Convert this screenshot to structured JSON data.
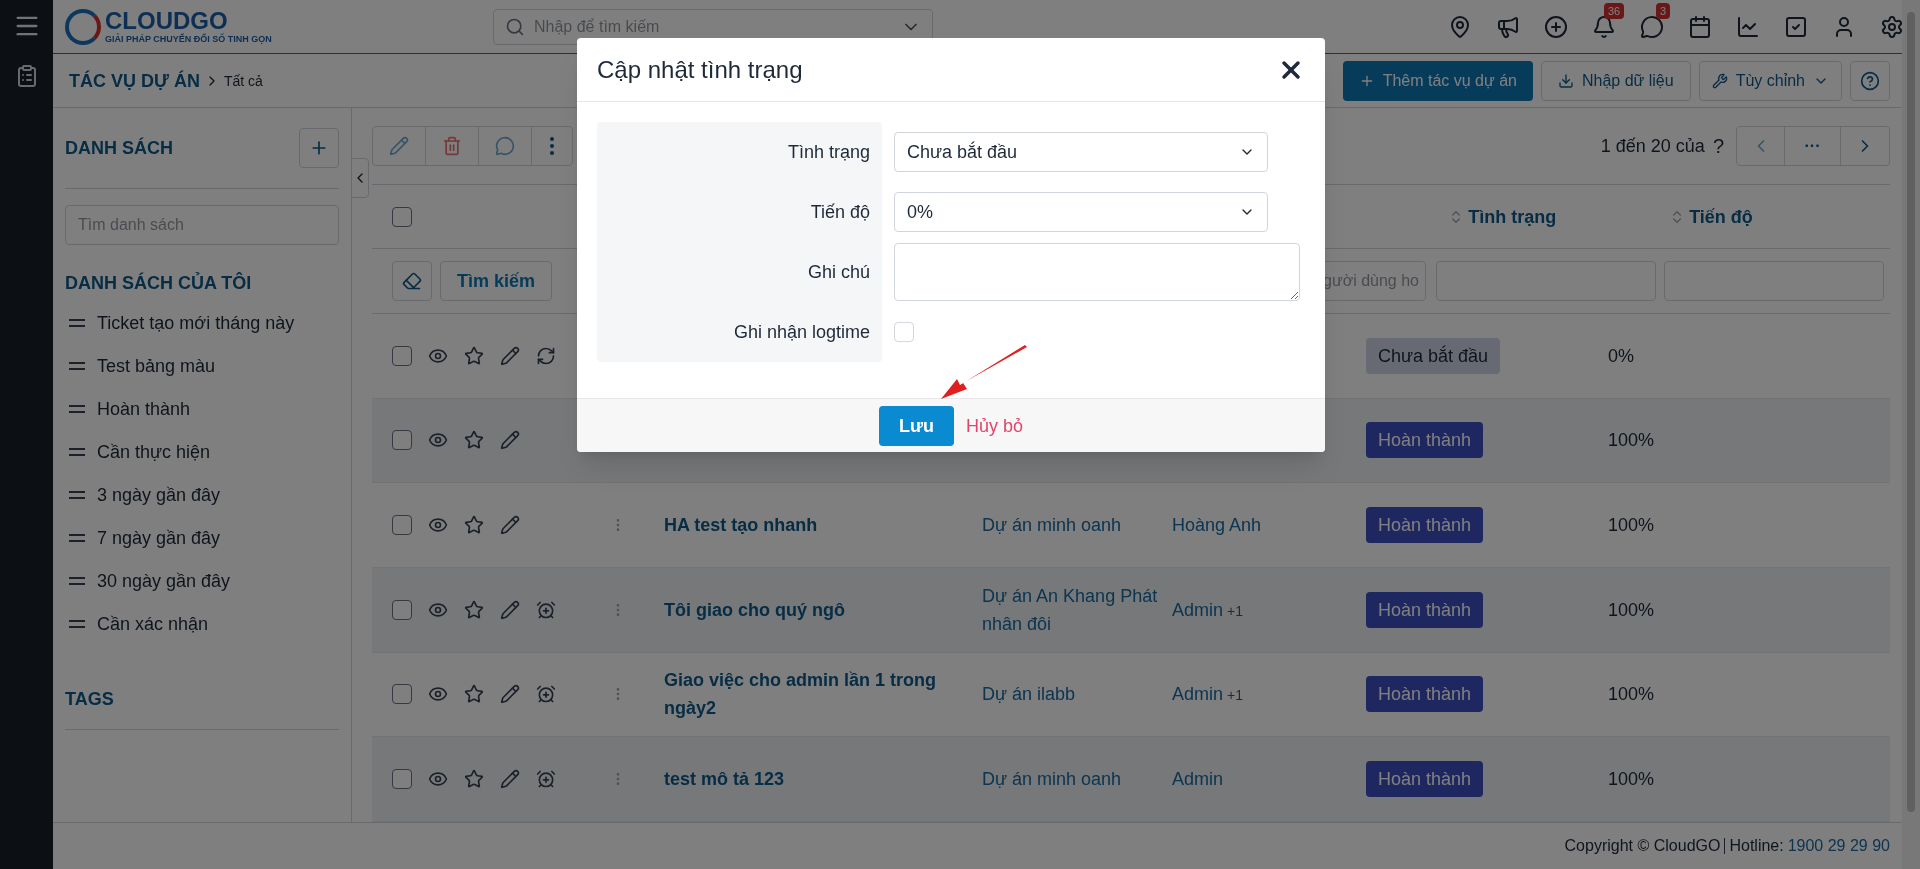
{
  "topbar": {
    "logo": "CLOUDGO",
    "logo_tagline": "GIẢI PHÁP CHUYỂN ĐỔI SỐ TINH GỌN",
    "search": {
      "placeholder": "Nhập để tìm kiếm"
    },
    "badges": {
      "notifications": "36",
      "messages": "3"
    }
  },
  "header": {
    "breadcrumb": "TÁC VỤ DỰ ÁN",
    "crumb": "Tất cả",
    "buttons": [
      {
        "kind": "primary",
        "label": "Thêm tác vụ dự án"
      },
      {
        "kind": "import",
        "label": "Nhập dữ liệu"
      },
      {
        "kind": "customize",
        "label": "Tùy chỉnh"
      },
      {
        "kind": "help"
      }
    ]
  },
  "sidebar": {
    "title": "DANH SÁCH",
    "search": {
      "placeholder": "Tìm danh sách"
    },
    "section": "DANH SÁCH CỦA TÔI",
    "items": [
      "Ticket tạo mới tháng này",
      "Test bảng màu",
      "Hoàn thành",
      "Cần thực hiện",
      "3 ngày gần đây",
      "7 ngày gần đây",
      "30 ngày gần đây",
      "Cần xác nhận"
    ],
    "tags_title": "TAGS"
  },
  "toolbar": {
    "search_button": "Tìm kiếm",
    "pagination": "1 đến 20 của",
    "unknown_total": "?",
    "more_pages": "···"
  },
  "table": {
    "select_all_checked": false,
    "columns": [
      "Tình trạng",
      "Tiến độ"
    ],
    "filter_placeholder": "gười dùng ho",
    "rows": [
      {
        "kind": "recurring",
        "checked": false,
        "status": {
          "label": "Chưa bắt đầu",
          "kind": "pending"
        },
        "progress": "0%"
      },
      {
        "kind": "plain",
        "checked": false,
        "status": {
          "label": "Hoàn thành",
          "kind": "done"
        },
        "progress": "100%"
      },
      {
        "kind": "plain",
        "checked": false,
        "name": "HA test tạo nhanh",
        "project": "Dự án minh oanh",
        "assignee": "Hoàng Anh",
        "status": {
          "label": "Hoàn thành",
          "kind": "done"
        },
        "progress": "100%"
      },
      {
        "kind": "reminder",
        "checked": false,
        "name": "Tôi giao cho quý ngô",
        "project": "Dự án An Khang Phát nhân đôi",
        "assignee": "Admin",
        "extra": "+1",
        "status": {
          "label": "Hoàn thành",
          "kind": "done"
        },
        "progress": "100%"
      },
      {
        "kind": "reminder",
        "checked": false,
        "name": "Giao việc cho admin lần 1 trong ngày2",
        "project": "Dự án ilabb",
        "assignee": "Admin",
        "extra": "+1",
        "status": {
          "label": "Hoàn thành",
          "kind": "done"
        },
        "progress": "100%"
      },
      {
        "kind": "reminder",
        "checked": false,
        "name": "test mô tả 123",
        "project": "Dự án minh oanh",
        "assignee": "Admin",
        "status": {
          "label": "Hoàn thành",
          "kind": "done"
        },
        "progress": "100%"
      }
    ]
  },
  "footer": {
    "copyright": "Copyright © CloudGO",
    "hotline_label": "Hotline:",
    "hotline": "1900 29 29 90"
  },
  "modal": {
    "title": "Cập nhật tình trạng",
    "fields": [
      {
        "kind": "select",
        "label": "Tình trạng",
        "value": "Chưa bắt đầu"
      },
      {
        "kind": "select",
        "label": "Tiến độ",
        "value": "0%"
      },
      {
        "kind": "textarea",
        "label": "Ghi chú"
      },
      {
        "kind": "checkbox",
        "label": "Ghi nhận logtime",
        "checked": false
      }
    ],
    "save": "Lưu",
    "cancel": "Hủy bỏ"
  }
}
